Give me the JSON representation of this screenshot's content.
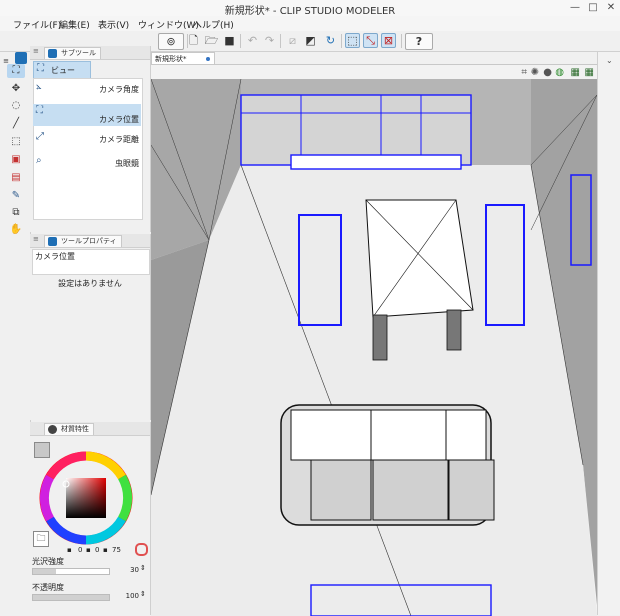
{
  "window": {
    "title": "新規形状* - CLIP STUDIO MODELER",
    "minimize_glyph": "—",
    "maximize_glyph": "□",
    "close_glyph": "✕"
  },
  "menu": [
    "ファイル(F)",
    "編集(E)",
    "表示(V)",
    "ウィンドウ(W)",
    "ヘルプ(H)"
  ],
  "toolbar_icons": [
    "view-mode-icon",
    "new-file-icon",
    "open-folder-icon",
    "save-icon",
    "undo-icon",
    "redo-icon",
    "edit-disabled-icon",
    "shading-icon",
    "refresh-icon",
    "select-frame-icon",
    "scale-arrows-icon",
    "transform-red-icon",
    "help-icon"
  ],
  "left_tools": [
    "view-tool-icon",
    "move-tool-icon",
    "lasso-tool-icon",
    "line-tool-icon",
    "cube-tool-icon",
    "object-tool-icon",
    "material-tool-icon",
    "pen-tool-icon",
    "node-tool-icon",
    "fill-tool-icon"
  ],
  "subtool_panel": {
    "tab_label": "サブツール",
    "group_label": "ビュー",
    "items": [
      "カメラ角度",
      "カメラ位置",
      "カメラ距離",
      "虫眼鏡"
    ],
    "selected_index": 1
  },
  "tool_property_panel": {
    "tab_label": "ツールプロパティ",
    "header": "カメラ位置",
    "message": "設定はありません"
  },
  "material_panel": {
    "tab_label": "材質特性",
    "rgb_readout": [
      "0",
      "0",
      "75"
    ],
    "gloss_label": "光沢強度",
    "gloss_value": "30",
    "opacity_label": "不透明度",
    "opacity_value": "100",
    "gloss_level": 0.3,
    "opacity_level": 1.0
  },
  "document": {
    "tab_label": "新規形状*",
    "accent": "#3474c4"
  },
  "colors": {
    "model_outline": "#1a1aff",
    "floor": "#ededed",
    "wall": "#a6a6a6"
  }
}
